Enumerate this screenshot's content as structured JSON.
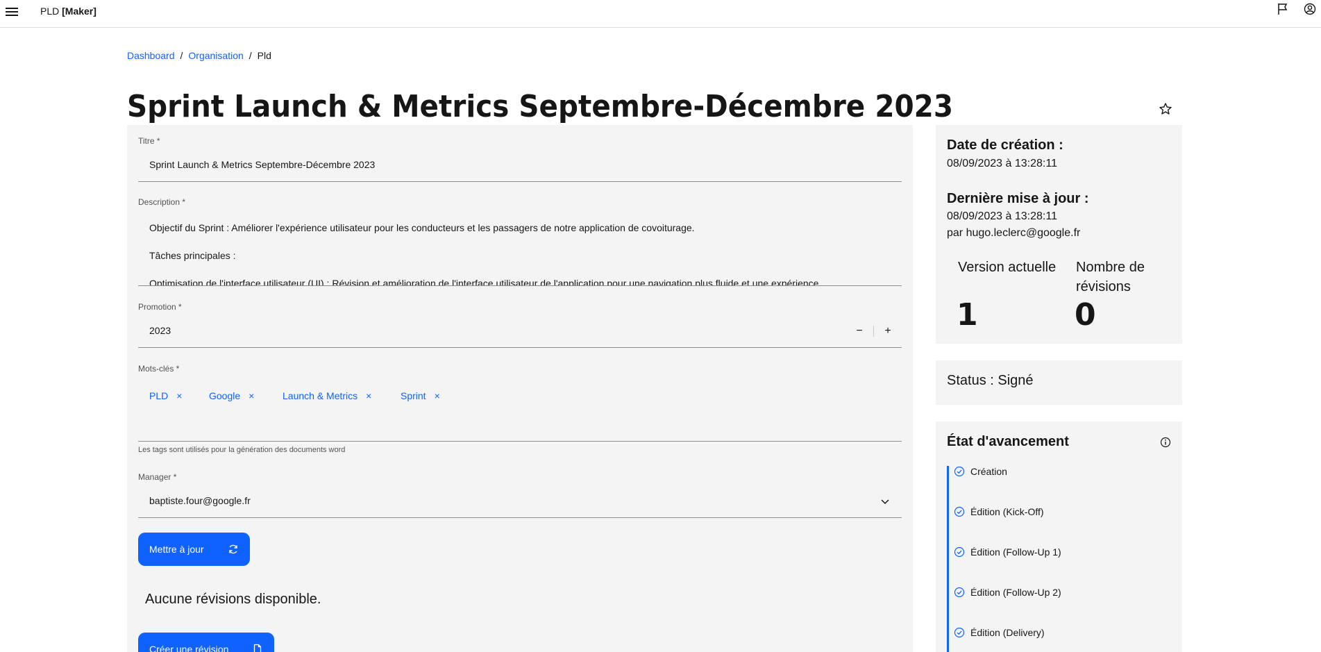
{
  "header": {
    "brand_prefix": "PLD",
    "brand_suffix": "[Maker]",
    "icons": [
      "menu-icon",
      "flag-icon",
      "user-avatar-icon"
    ]
  },
  "breadcrumb": {
    "items": [
      "Dashboard",
      "Organisation"
    ],
    "separator": "/",
    "current": "Pld"
  },
  "page": {
    "title": "Sprint Launch & Metrics Septembre-Décembre 2023"
  },
  "form": {
    "title_label": "Titre *",
    "title_value": "Sprint Launch & Metrics Septembre-Décembre 2023",
    "description_label": "Description *",
    "description_lines": [
      " Objectif du Sprint : Améliorer l'expérience utilisateur pour les conducteurs et les passagers de notre application de covoiturage.",
      "Tâches principales :",
      "Optimisation de l'interface utilisateur (UI) : Révision et amélioration de l'interface utilisateur de l'application pour une navigation plus fluide et une expérience"
    ],
    "promotion_label": "Promotion *",
    "promotion_value": "2023",
    "stepper_minus": "−",
    "stepper_plus": "+",
    "keywords_label": "Mots-clés *",
    "tags": [
      "PLD",
      "Google",
      "Launch & Metrics",
      "Sprint"
    ],
    "tag_remove": "×",
    "keywords_helper": "Les tags sont utilisés pour la génération des documents word",
    "manager_label": "Manager *",
    "manager_value": "baptiste.four@google.fr",
    "update_button": "Mettre à jour",
    "no_revisions": "Aucune révisions disponible.",
    "create_revision_button": "Créer une révision"
  },
  "info_card": {
    "created_label": "Date de création :",
    "created_value": "08/09/2023 à 13:28:11",
    "updated_label": "Dernière mise à jour :",
    "updated_value": "08/09/2023 à 13:28:11",
    "updated_by": "par hugo.leclerc@google.fr",
    "version_label": "Version actuelle",
    "version_value": "1",
    "revisions_label": "Nombre de révisions",
    "revisions_value": "0"
  },
  "status_card": {
    "text": "Status : Signé"
  },
  "progress_card": {
    "title": "État d'avancement",
    "steps": [
      "Création",
      "Édition (Kick-Off)",
      "Édition (Follow-Up 1)",
      "Édition (Follow-Up 2)",
      "Édition (Delivery)"
    ],
    "accent_color": "#0f62fe"
  },
  "colors": {
    "primary": "#0f62fe",
    "panel_bg": "#f4f4f4",
    "text": "#161616"
  }
}
